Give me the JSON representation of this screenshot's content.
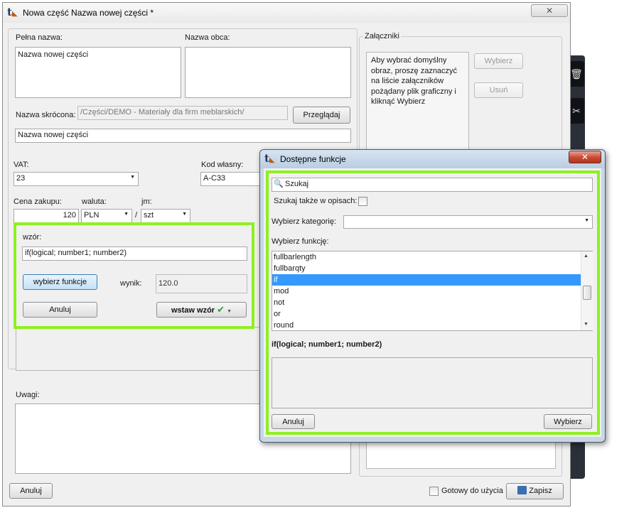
{
  "main_window": {
    "title": "Nowa część Nazwa nowej części *",
    "close_glyph": "✕",
    "labels": {
      "full_name": "Pełna nazwa:",
      "foreign_name": "Nazwa obca:",
      "short_name": "Nazwa skrócona:",
      "vat": "VAT:",
      "own_code": "Kod własny:",
      "purchase_price": "Cena zakupu:",
      "currency": "waluta:",
      "unit": "jm:",
      "unit_separator": "/",
      "notes": "Uwagi:",
      "attachments": "Załączniki"
    },
    "values": {
      "full_name": "Nazwa nowej części",
      "foreign_name": "",
      "short_name_path": "/Części/DEMO - Materiały dla firm meblarskich/",
      "short_name": "Nazwa nowej części",
      "vat": "23",
      "own_code": "A-C33",
      "purchase_price": "120",
      "currency": "PLN",
      "unit": "szt",
      "notes": ""
    },
    "attachments_hint": "Aby wybrać domyślny obraz, proszę zaznaczyć na liście załączników pożądany plik graficzny i kliknąć Wybierz",
    "buttons": {
      "browse": "Przeglądaj",
      "choose": "Wybierz",
      "delete": "Usuń",
      "cancel": "Anuluj",
      "save": "Zapisz"
    },
    "ready_checkbox_label": "Gotowy do użycia",
    "ready_checked": false
  },
  "formula_panel": {
    "label": "wzór:",
    "formula": "if(logical; number1; number2)",
    "choose_function_button": "wybierz funkcje",
    "result_label": "wynik:",
    "result_value": "120.0",
    "cancel_button": "Anuluj",
    "insert_button": "wstaw wzór"
  },
  "functions_dialog": {
    "title": "Dostępne funkcje",
    "search_placeholder": "Szukaj",
    "search_descriptions_label": "Szukaj także w opisach:",
    "search_descriptions_checked": false,
    "category_label": "Wybierz kategorię:",
    "category_value": "",
    "function_label": "Wybierz funkcję:",
    "functions": [
      "fullbarlength",
      "fullbarqty",
      "if",
      "mod",
      "not",
      "or",
      "round"
    ],
    "selected_index": 2,
    "signature": "if(logical; number1; number2)",
    "description": "",
    "cancel_button": "Anuluj",
    "choose_button": "Wybierz"
  },
  "colors": {
    "highlight_green": "#8ef021",
    "selection_blue": "#3399ff"
  }
}
